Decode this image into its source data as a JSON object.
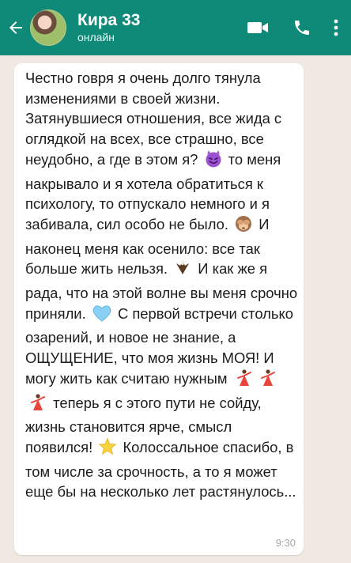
{
  "header": {
    "contact_name": "Кира 33",
    "status": "онлайн",
    "colors": {
      "bar": "#0f8a78",
      "text": "#ffffff"
    },
    "icons": [
      "back-arrow-icon",
      "video-call-icon",
      "phone-icon",
      "more-vert-icon"
    ]
  },
  "message": {
    "seg1": "Честно говря я очень долго тянула  изменениями в своей жизни. Затянувшиеся отношения, все жида с оглядкой на всех, все страшно, все неудобно, а где в этом я?",
    "seg2": "то меня накрывало и я хотела обратиться к психологу, то отпускало немного и я забивала, сил особо не было.",
    "seg3": "И наконец меня как осенило: все так больше жить нельзя.",
    "seg4": "И как же я рада, что на этой волне вы меня срочно приняли.",
    "seg5": "С первой встречи столько озарений, и новое не знание, а ОЩУЩЕНИЕ, что моя жизнь МОЯ! И могу жить как считаю нужным",
    "seg6": "теперь я с этого пути не сойду, жизнь становится ярче, смысл появился!",
    "seg7": "Колоссальное спасибо, в том числе за срочность, а то я может еще бы на несколько лет растянулось...",
    "time": "9:30",
    "emojis": [
      "smiling-devil-emoji",
      "see-no-evil-monkey-emoji",
      "eagle-emoji",
      "light-blue-heart-emoji",
      "dancer-emoji",
      "dancer-emoji",
      "dancer-emoji",
      "star-emoji"
    ]
  }
}
